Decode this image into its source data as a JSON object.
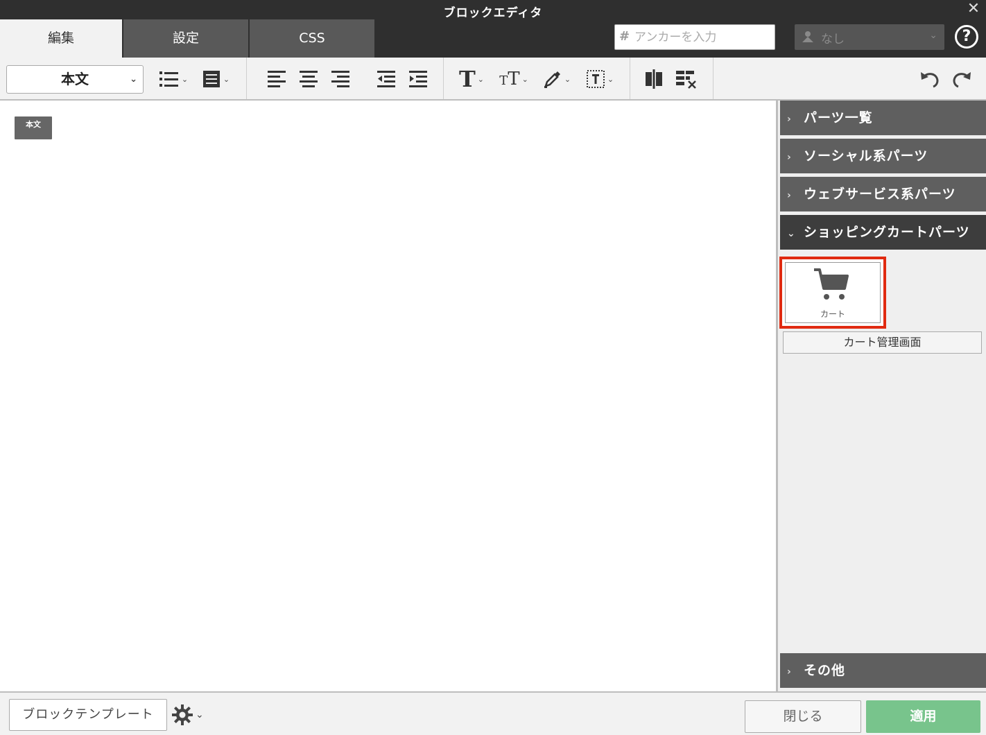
{
  "window": {
    "title": "ブロックエディタ"
  },
  "tabs": [
    {
      "label": "編集",
      "active": true
    },
    {
      "label": "設定",
      "active": false
    },
    {
      "label": "CSS",
      "active": false
    }
  ],
  "anchor": {
    "placeholder": "アンカーを入力"
  },
  "role_select": {
    "value": "なし"
  },
  "toolbar": {
    "style_select": "本文",
    "icons": [
      "list-icon",
      "block-icon",
      "align-left-icon",
      "align-center-icon",
      "align-right-icon",
      "outdent-icon",
      "indent-icon",
      "text-style-icon",
      "font-size-icon",
      "color-picker-icon",
      "border-icon",
      "column-icon",
      "table-icon",
      "undo-icon",
      "redo-icon"
    ]
  },
  "editor": {
    "block_badge": "本文"
  },
  "panel": {
    "sections": [
      {
        "label": "パーツ一覧",
        "open": false
      },
      {
        "label": "ソーシャル系パーツ",
        "open": false
      },
      {
        "label": "ウェブサービス系パーツ",
        "open": false
      },
      {
        "label": "ショッピングカートパーツ",
        "open": true
      },
      {
        "label": "その他",
        "open": false
      }
    ],
    "cart_item_label": "カート",
    "cart_admin_label": "カート管理画面"
  },
  "footer": {
    "template_label": "ブロックテンプレート",
    "close_label": "閉じる",
    "apply_label": "適用"
  },
  "colors": {
    "highlight": "#e02a10",
    "apply": "#78c48c",
    "dark": "#2f2f2f"
  }
}
